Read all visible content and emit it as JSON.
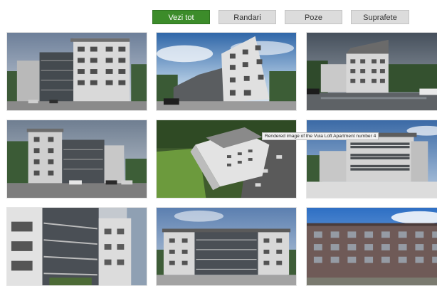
{
  "filters": [
    {
      "label": "Vezi tot",
      "active": true
    },
    {
      "label": "Randari",
      "active": false
    },
    {
      "label": "Poze",
      "active": false
    },
    {
      "label": "Suprafete",
      "active": false
    }
  ],
  "gallery": {
    "tooltip": "Rendered image of the Vuia Loft Apartment number 4",
    "items": [
      {
        "kind": "rendering"
      },
      {
        "kind": "rendering"
      },
      {
        "kind": "rendering"
      },
      {
        "kind": "rendering"
      },
      {
        "kind": "rendering"
      },
      {
        "kind": "rendering"
      },
      {
        "kind": "rendering"
      },
      {
        "kind": "rendering"
      },
      {
        "kind": "rendering"
      }
    ]
  },
  "colors": {
    "active_filter": "#3c8c2a",
    "inactive_filter": "#dcdcdc"
  }
}
